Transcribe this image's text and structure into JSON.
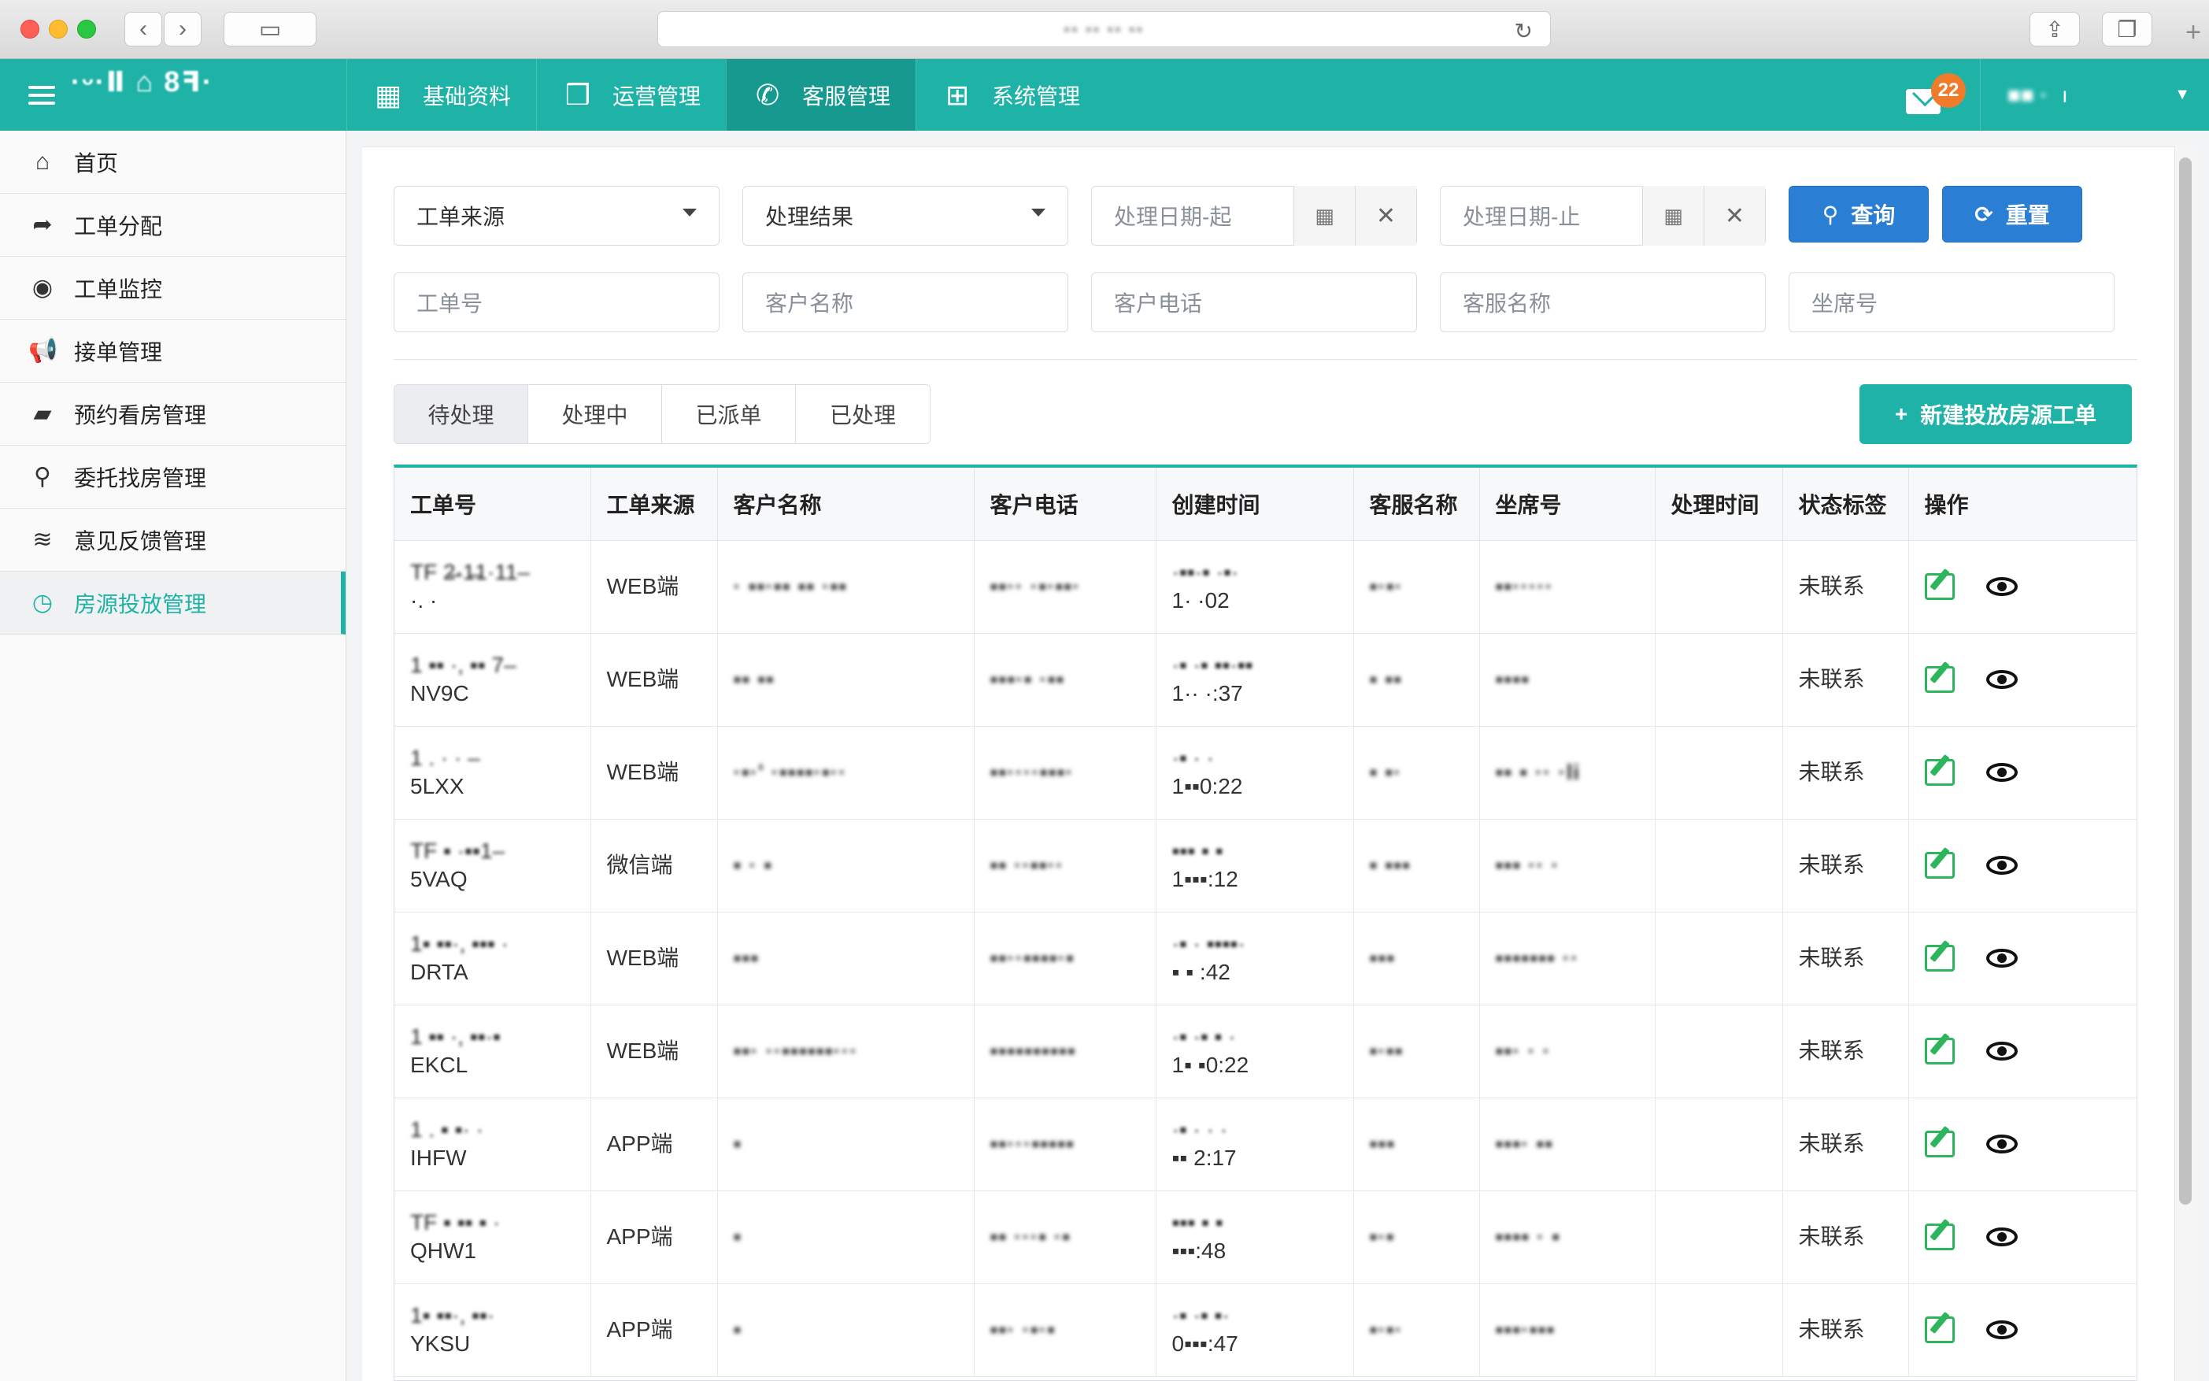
{
  "browser": {
    "url": "·· ·· ·· ··"
  },
  "header": {
    "brand": "·ᵕ·Ⅱ ⌂ 8ꟻ·",
    "nav": [
      {
        "label": "基础资料",
        "icon": "building-icon"
      },
      {
        "label": "运营管理",
        "icon": "cubes-icon"
      },
      {
        "label": "客服管理",
        "icon": "phone-icon",
        "active": true
      },
      {
        "label": "系统管理",
        "icon": "sitemap-icon"
      }
    ],
    "mail_count": "22",
    "user_name": "■■ ·",
    "user_suffix": "ı"
  },
  "sidebar": {
    "items": [
      {
        "label": "首页",
        "icon": "home-icon"
      },
      {
        "label": "工单分配",
        "icon": "share-icon"
      },
      {
        "label": "工单监控",
        "icon": "eye-icon"
      },
      {
        "label": "接单管理",
        "icon": "bullhorn-icon"
      },
      {
        "label": "预约看房管理",
        "icon": "book-icon"
      },
      {
        "label": "委托找房管理",
        "icon": "search-icon"
      },
      {
        "label": "意见反馈管理",
        "icon": "rss-icon"
      },
      {
        "label": "房源投放管理",
        "icon": "clock-icon",
        "active": true
      }
    ]
  },
  "filters": {
    "source_select": "工单来源",
    "result_select": "处理结果",
    "date_start_placeholder": "处理日期-起",
    "date_end_placeholder": "处理日期-止",
    "query_button": "查询",
    "reset_button": "重置",
    "order_no_placeholder": "工单号",
    "customer_name_placeholder": "客户名称",
    "customer_phone_placeholder": "客户电话",
    "agent_name_placeholder": "客服名称",
    "seat_no_placeholder": "坐席号"
  },
  "tabs": [
    "待处理",
    "处理中",
    "已派单",
    "已处理"
  ],
  "new_button": "新建投放房源工单",
  "table": {
    "columns": [
      "工单号",
      "工单来源",
      "客户名称",
      "客户电话",
      "创建时间",
      "客服名称",
      "坐席号",
      "处理时间",
      "状态标签",
      "操作"
    ],
    "rows": [
      {
        "order_top": "TF 2̶·1̶1·11–",
        "order_bottom": "·. ·",
        "source": "WEB端",
        "name": "·  ▪▪·▪▪ ▪▪ ·▪▪",
        "phone": "▪▪·· ·▪·▪▪·",
        "time_top": "·▪▪·▪ ·▪·",
        "time_bottom": "1· ·02",
        "agent": "▪·▪·",
        "seat": "▪▪·····",
        "handled": "",
        "status": "未联系"
      },
      {
        "order_top": "1 ▪▪ ·, ▪▪ 7–",
        "order_bottom": "NV9C",
        "source": "WEB端",
        "name": "▪▪ ▪▪",
        "phone": "▪▪▪·▪ ·▪▪",
        "time_top": "·▪ ·▪ ▪▪·▪▪",
        "time_bottom": "1·· ·:37",
        "agent": "▪ ▪▪",
        "seat": "▪▪▪▪",
        "handled": "",
        "status": "未联系"
      },
      {
        "order_top": "1 . ·  ·  –",
        "order_bottom": "5LXX",
        "source": "WEB端",
        "name": "·▪·' ·▪▪▪▪·▪··",
        "phone": "▪▪····▪▪▪·",
        "time_top": "·▪ · ·",
        "time_bottom": "1▪▪0:22",
        "agent": "▪ ▪·",
        "seat": "▪▪ ▪ ·· ·li",
        "handled": "",
        "status": "未联系"
      },
      {
        "order_top": "TF ▪ ·▪▪1–",
        "order_bottom": "5VAQ",
        "source": "微信端",
        "name": "▪ · ▪",
        "phone": "▪▪ ··▪▪··",
        "time_top": "▪▪▪ ▪ ▪",
        "time_bottom": "1▪▪▪:12",
        "agent": "▪ ▪▪▪",
        "seat": "▪▪▪ ·· ·",
        "handled": "",
        "status": "未联系"
      },
      {
        "order_top": "1▪ ▪▪·, ▪▪▪ ·",
        "order_bottom": "DRTA",
        "source": "WEB端",
        "name": "▪▪▪",
        "phone": "▪▪··▪▪▪▪·▪",
        "time_top": "·▪ · ▪▪▪▪·",
        "time_bottom": "▪ ▪ :42",
        "agent": "▪▪▪",
        "seat": "▪▪▪▪▪▪▪ ··",
        "handled": "",
        "status": "未联系"
      },
      {
        "order_top": "1 ▪▪ ·, ▪▪·▪",
        "order_bottom": "EKCL",
        "source": "WEB端",
        "name": "▪▪· ··▪▪▪▪▪▪···",
        "phone": "▪▪▪▪▪▪▪▪▪▪",
        "time_top": "·▪ ·▪ ▪ ·",
        "time_bottom": "1▪ ▪0:22",
        "agent": "▪·▪▪",
        "seat": "▪▪·   · ·",
        "handled": "",
        "status": "未联系"
      },
      {
        "order_top": "1 .  ▪ ▪·  ·",
        "order_bottom": "IHFW",
        "source": "APP端",
        "name": "▪",
        "phone": "▪▪···▪▪▪▪▪",
        "time_top": "·▪ ·  · ·",
        "time_bottom": "▪▪ 2:17",
        "agent": "▪▪▪",
        "seat": "▪▪▪· ▪▪",
        "handled": "",
        "status": "未联系"
      },
      {
        "order_top": "TF ▪ ▪▪ ▪ ·",
        "order_bottom": "QHW1",
        "source": "APP端",
        "name": "▪",
        "phone": "▪▪ ···▪ ·▪",
        "time_top": "▪▪▪ ▪ ▪",
        "time_bottom": "▪▪▪:48",
        "agent": "▪·▪",
        "seat": "▪▪▪▪ · ▪",
        "handled": "",
        "status": "未联系"
      },
      {
        "order_top": "1▪ ▪▪·, ▪▪·",
        "order_bottom": "YKSU",
        "source": "APP端",
        "name": "▪",
        "phone": "▪▪·  ·▪·▪",
        "time_top": "·▪ ·▪ ▪·",
        "time_bottom": "0▪▪▪:47",
        "agent": "▪·▪·",
        "seat": "▪▪▪·▪▪▪",
        "handled": "",
        "status": "未联系"
      }
    ]
  },
  "colors": {
    "teal": "#1fb3a8",
    "blue": "#2a7fd4",
    "badge": "#f07b2b"
  }
}
